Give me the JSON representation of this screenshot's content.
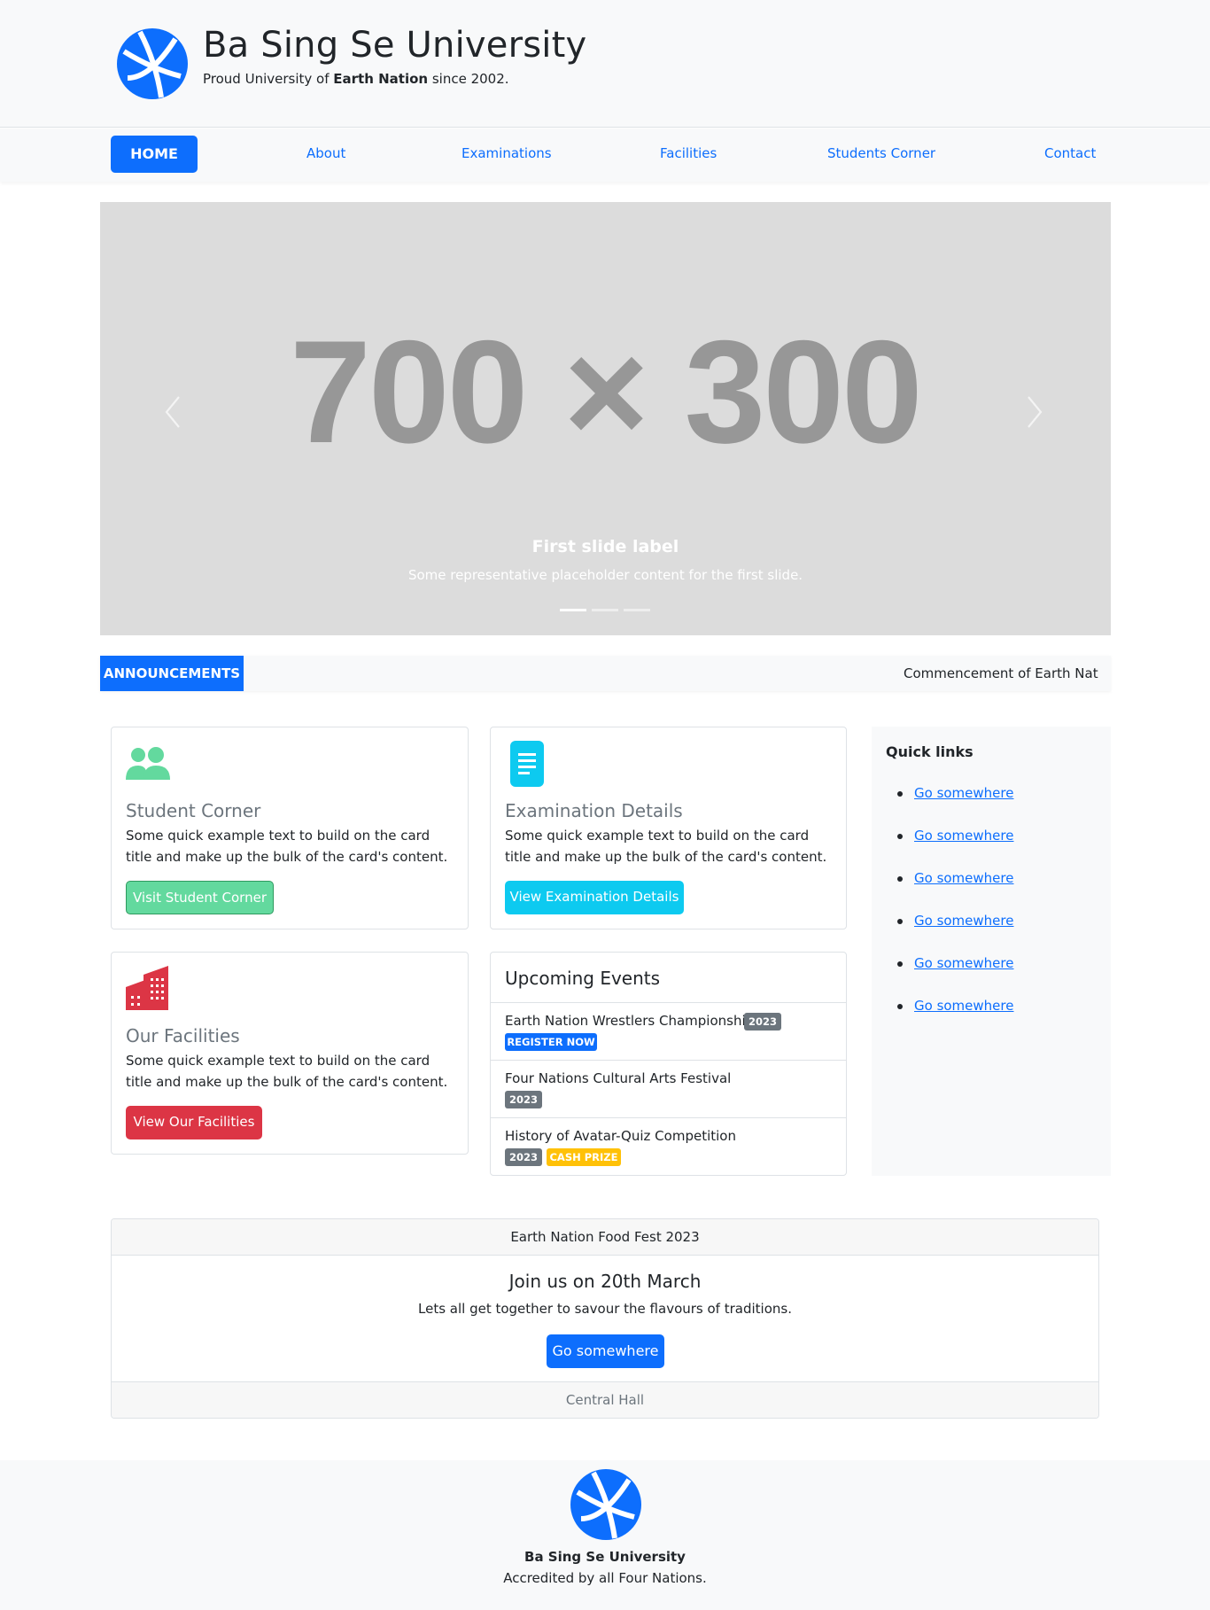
{
  "brand": {
    "title": "Ba Sing Se University",
    "subtitle_pre": "Proud University of ",
    "subtitle_bold": "Earth Nation",
    "subtitle_post": " since 2002.",
    "logo_icon": "globe-icon",
    "accent_color": "#0d6efd"
  },
  "nav": {
    "home": "HOME",
    "links": [
      "About",
      "Examinations",
      "Facilities",
      "Students Corner",
      "Contact"
    ]
  },
  "carousel": {
    "placeholder": "700 × 300",
    "caption_title": "First slide label",
    "caption_text": "Some representative placeholder content for the first slide.",
    "prev_icon": "chevron-left-icon",
    "next_icon": "chevron-right-icon",
    "active_slide": 1,
    "slide_count": 3
  },
  "announcements": {
    "label": "ANNOUNCEMENTS",
    "text": "Commencement of Earth Nation"
  },
  "cards": [
    {
      "icon": "people-icon",
      "title": "Student Corner",
      "text": "Some quick example text to build on the card title and make up the bulk of the card's content.",
      "button": "Visit Student Corner",
      "color": "#63d99e"
    },
    {
      "icon": "document-icon",
      "title": "Examination Details",
      "text": "Some quick example text to build on the card title and make up the bulk of the card's content.",
      "button": "View Examination Details",
      "color": "#0dcaf0"
    },
    {
      "icon": "building-icon",
      "title": "Our Facilities",
      "text": "Some quick example text to build on the card title and make up the bulk of the card's content.",
      "button": "View Our Facilities",
      "color": "#dc3545"
    }
  ],
  "events": {
    "title": "Upcoming Events",
    "items": [
      {
        "name": "Earth Nation Wrestlers Championship",
        "year": "2023",
        "extra": "REGISTER NOW"
      },
      {
        "name": "Four Nations Cultural Arts Festival",
        "year": "2023"
      },
      {
        "name": "History of Avatar-Quiz Competition",
        "year": "2023",
        "extra": "CASH PRIZE"
      }
    ]
  },
  "quick_links": {
    "title": "Quick links",
    "links": [
      "Go somewhere",
      "Go somewhere",
      "Go somewhere",
      "Go somewhere",
      "Go somewhere",
      "Go somewhere"
    ]
  },
  "food_fest": {
    "header": "Earth Nation Food Fest 2023",
    "title": "Join us on 20th March",
    "text": "Lets all get together to savour the flavours of traditions.",
    "button": "Go somewhere",
    "footer": "Central Hall"
  },
  "footer": {
    "title": "Ba Sing Se University",
    "subtitle": "Accredited by all Four Nations."
  }
}
